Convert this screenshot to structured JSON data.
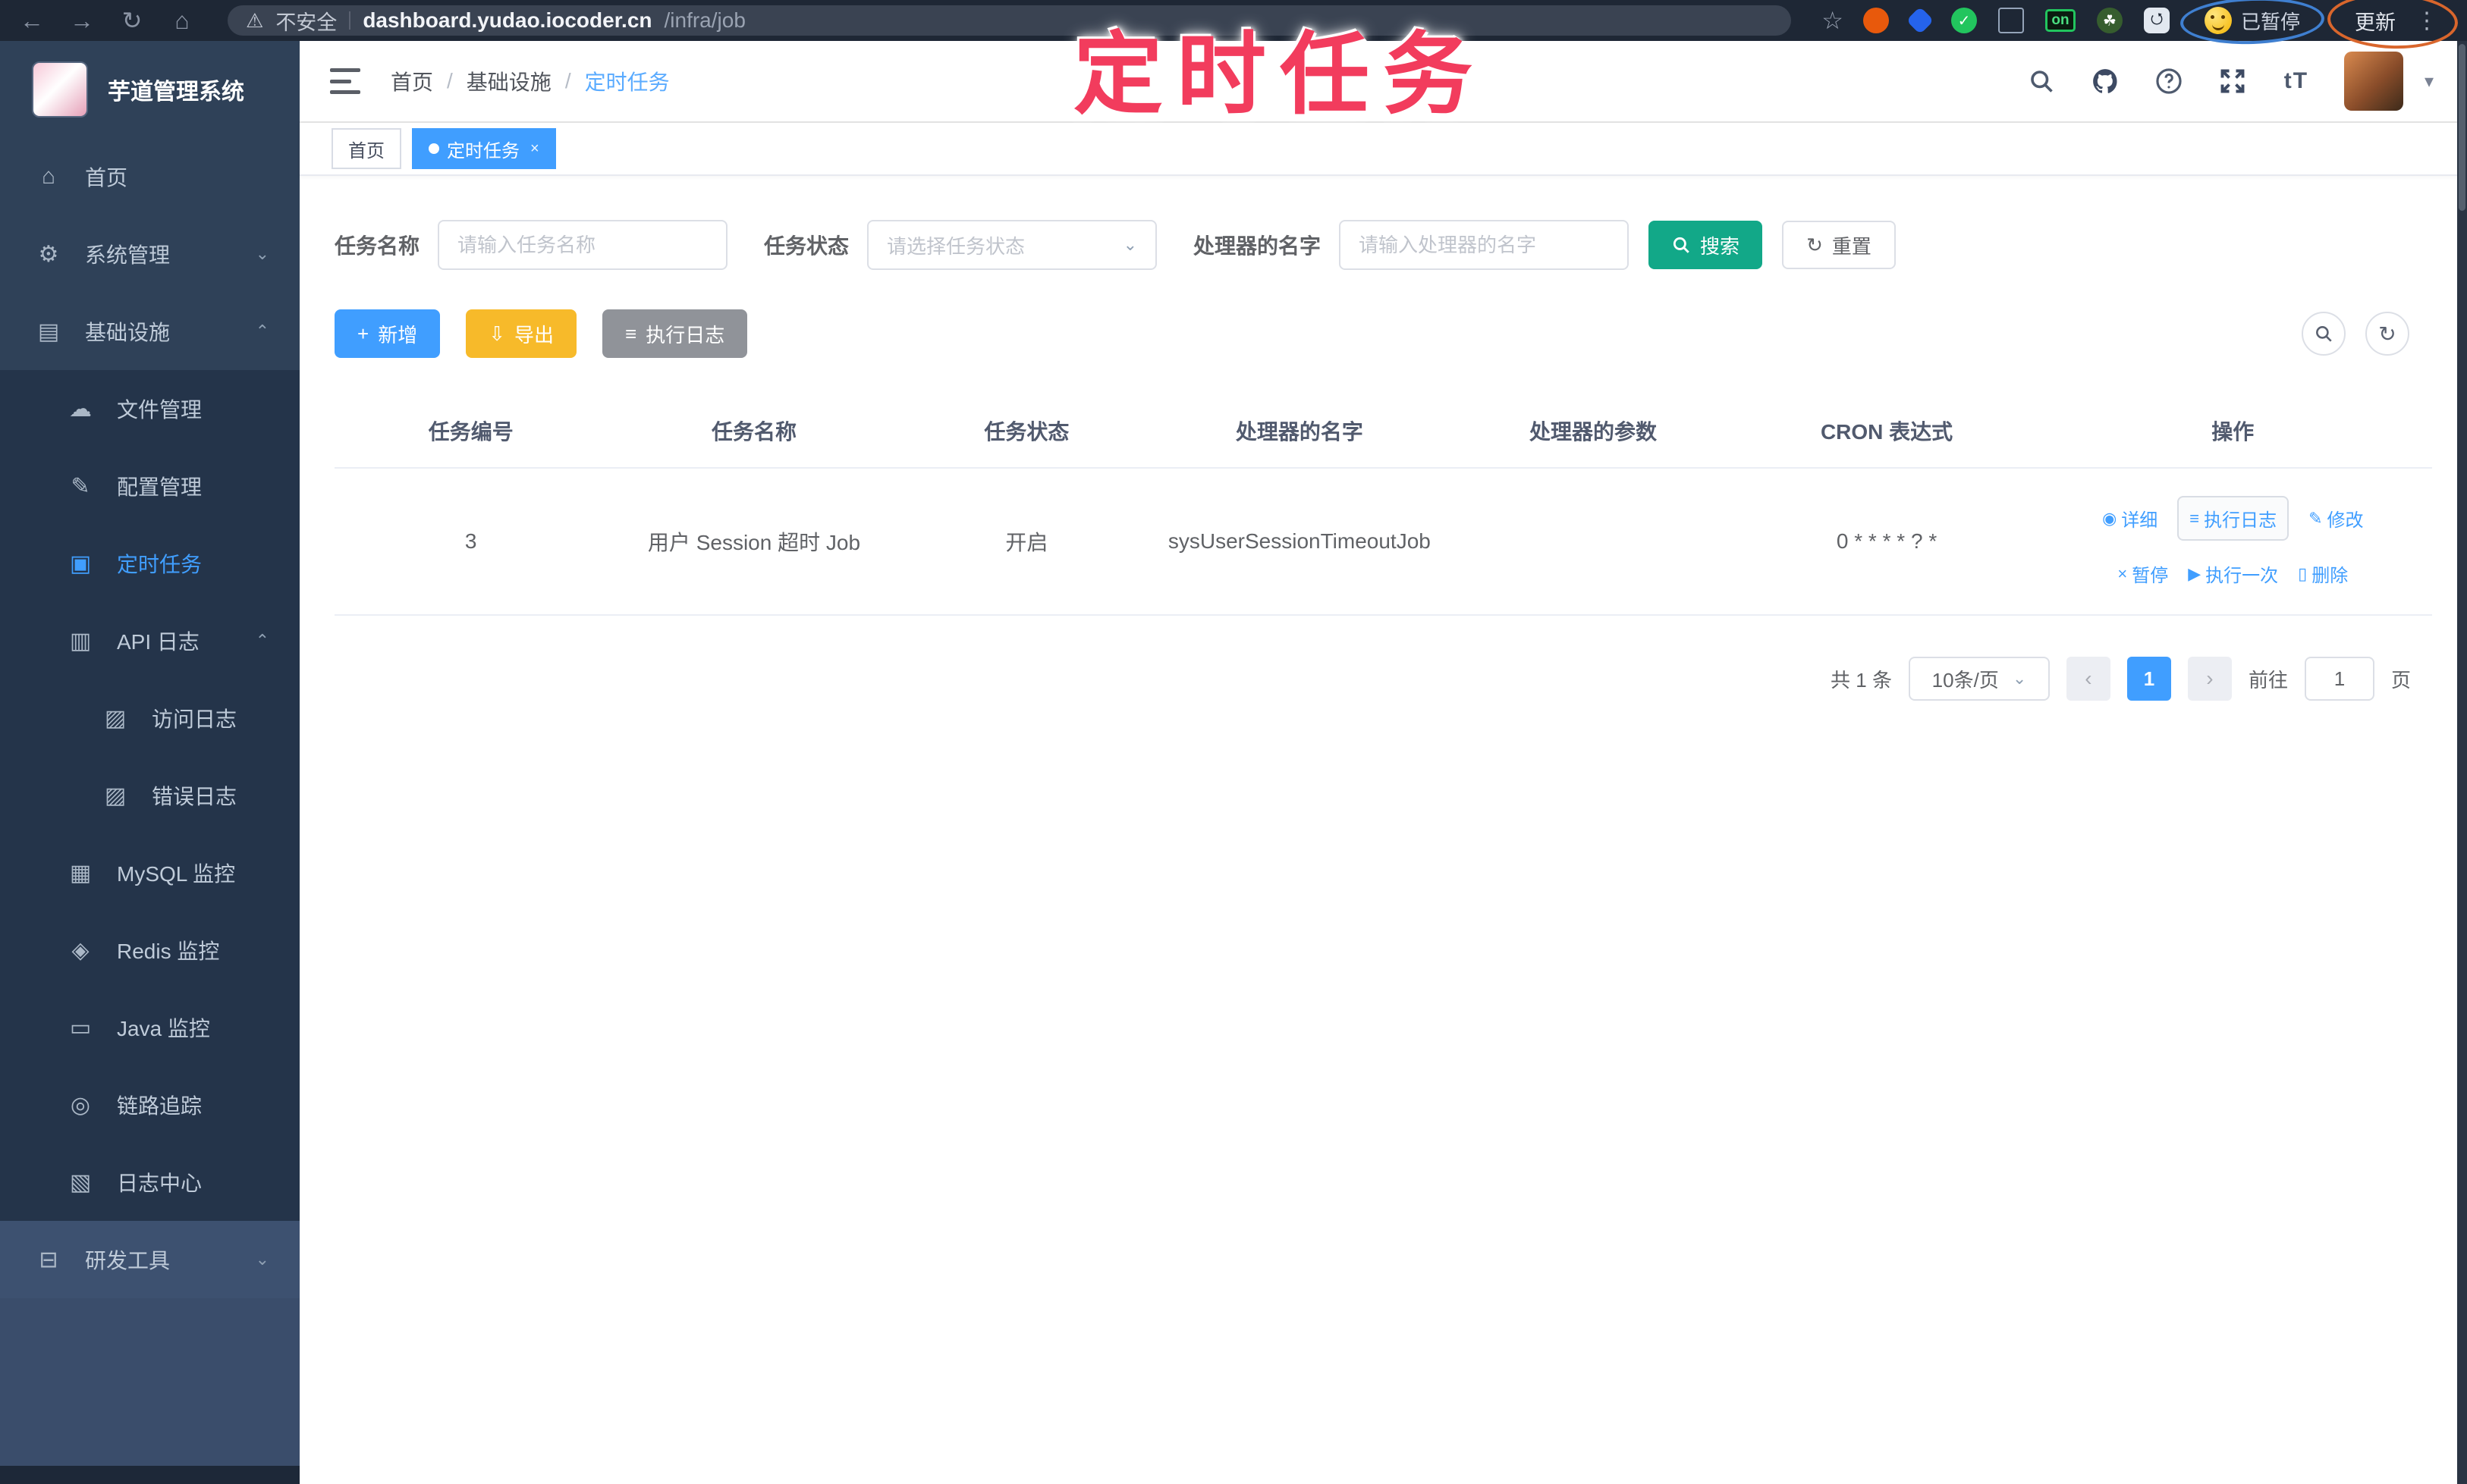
{
  "browser": {
    "insecure_label": "不安全",
    "url_host": "dashboard.yudao.iocoder.cn",
    "url_path": "/infra/job",
    "extension_badge": "on",
    "paused_chip": "已暂停",
    "update_button": "更新"
  },
  "annotation": {
    "text": "定时任务",
    "color": "#f23c5d"
  },
  "sidebar": {
    "title": "芋道管理系统",
    "items": [
      {
        "label": "首页"
      },
      {
        "label": "系统管理"
      },
      {
        "label": "基础设施"
      },
      {
        "label": "文件管理"
      },
      {
        "label": "配置管理"
      },
      {
        "label": "定时任务"
      },
      {
        "label": "API 日志"
      },
      {
        "label": "访问日志"
      },
      {
        "label": "错误日志"
      },
      {
        "label": "MySQL 监控"
      },
      {
        "label": "Redis 监控"
      },
      {
        "label": "Java 监控"
      },
      {
        "label": "链路追踪"
      },
      {
        "label": "日志中心"
      },
      {
        "label": "研发工具"
      }
    ]
  },
  "header": {
    "breadcrumb": [
      "首页",
      "基础设施",
      "定时任务"
    ],
    "font_icon_label": "tT"
  },
  "tabs": [
    {
      "label": "首页"
    },
    {
      "label": "定时任务"
    }
  ],
  "filters": {
    "name_label": "任务名称",
    "name_placeholder": "请输入任务名称",
    "status_label": "任务状态",
    "status_placeholder": "请选择任务状态",
    "handler_label": "处理器的名字",
    "handler_placeholder": "请输入处理器的名字",
    "search_label": "搜索",
    "reset_label": "重置"
  },
  "toolbar": {
    "add_label": "新增",
    "export_label": "导出",
    "exec_log_label": "执行日志"
  },
  "table": {
    "columns": [
      "任务编号",
      "任务名称",
      "任务状态",
      "处理器的名字",
      "处理器的参数",
      "CRON 表达式",
      "操作"
    ],
    "rows": [
      {
        "id": "3",
        "name": "用户 Session 超时 Job",
        "status": "开启",
        "handler": "sysUserSessionTimeoutJob",
        "param": "",
        "cron": "0 * * * * ? *"
      }
    ],
    "row_actions": [
      "详细",
      "执行日志",
      "修改",
      "暂停",
      "执行一次",
      "删除"
    ]
  },
  "pagination": {
    "total_label": "共 1 条",
    "page_size_label": "10条/页",
    "current_page": "1",
    "goto_label": "前往",
    "goto_value": "1",
    "page_suffix": "页"
  },
  "colors": {
    "accent": "#409eff",
    "search_button": "#12a888",
    "export_button": "#f7ba2a",
    "info_button": "#909399",
    "annotation": "#f23c5d",
    "sidebar_bg": "#2f4158"
  }
}
